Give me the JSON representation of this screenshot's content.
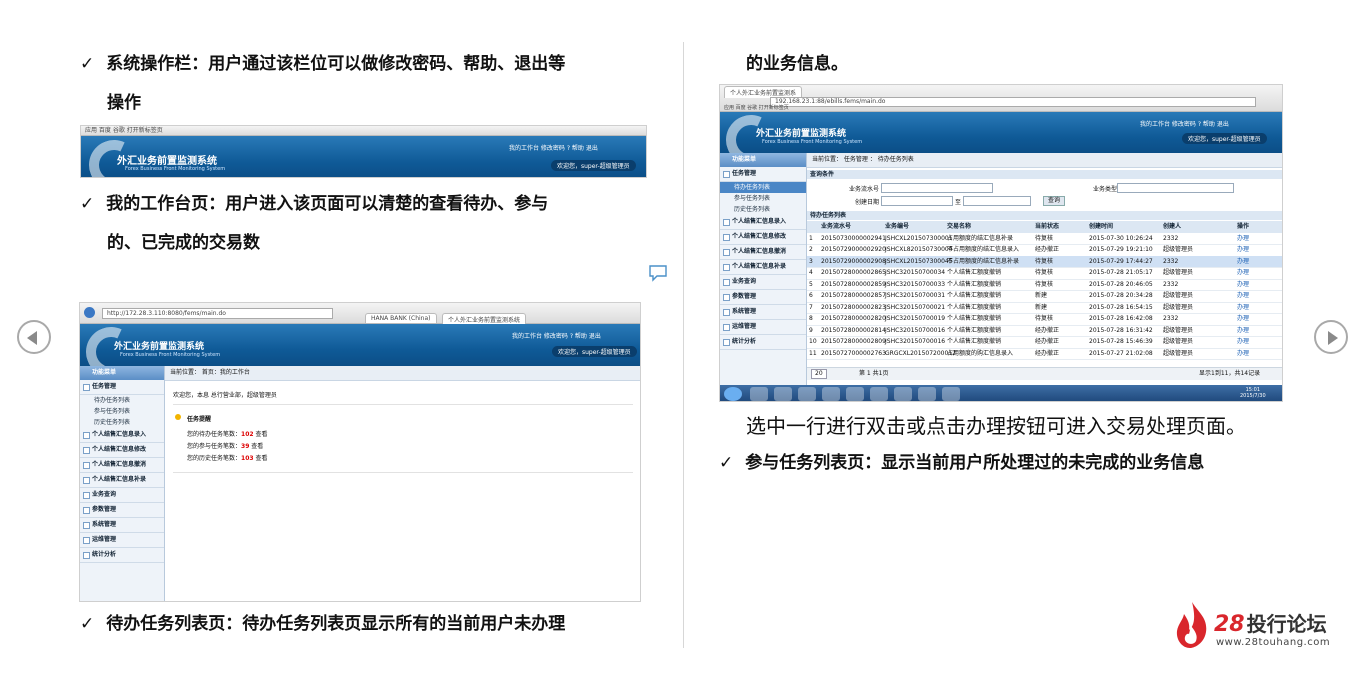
{
  "texts": {
    "left_bullet_1_line1": "系统操作栏：用户通过该栏位可以做修改密码、帮助、退出等",
    "left_bullet_1_line2": "操作",
    "left_bullet_2_line1": "我的工作台页：用户进入该页面可以清楚的查看待办、参与",
    "left_bullet_2_line2": "的、已完成的交易数",
    "left_bullet_3": "待办任务列表页：待办任务列表页显示所有的当前用户未办理",
    "right_top_cont": "的业务信息。",
    "right_caption": "选中一行进行双击或点击办理按钮可进入交易处理页面。",
    "right_bullet": "参与任务列表页：显示当前用户所处理过的未完成的业务信息"
  },
  "check_mark": "✓",
  "app": {
    "system_title": "外汇业务前置监测系统",
    "system_subtitle": "Forex Business Front Monitoring System",
    "links": "我的工作台  修改密码  ? 帮助  退出",
    "welcome": "欢迎您，super-超级管理员",
    "bookmarks": "应用  百度  谷歌  打开新标签页"
  },
  "shot2": {
    "address": "http://172.28.3.110:8080/fems/main.do",
    "tab1": "HANA BANK (China)",
    "tab2": "个人外汇业务前置监测系统",
    "side_head": "功能菜单",
    "side_items": [
      "任务管理",
      "个人结售汇信息录入",
      "个人结售汇信息修改",
      "个人结售汇信息撤消",
      "个人结售汇信息补录",
      "业务查询",
      "参数管理",
      "系统管理",
      "运维管理",
      "统计分析"
    ],
    "side_subs": [
      "待办任务列表",
      "参与任务列表",
      "历史任务列表"
    ],
    "crumb": "当前位置： 首页：我的工作台",
    "greeting": "欢迎您，本息  总行营业部，超级管理员",
    "reminder_title": "任务提醒",
    "lines": [
      {
        "label": "您的待办任务笔数：",
        "count": "102",
        "action": "查看"
      },
      {
        "label": "您的参与任务笔数：",
        "count": "39",
        "action": "查看"
      },
      {
        "label": "您的历史任务笔数：",
        "count": "103",
        "action": "查看"
      }
    ]
  },
  "shot3": {
    "window_tab": "个人外汇业务前置监测系",
    "address": "192.168.23.1:88/ebills.fems/main.do",
    "side_head": "功能菜单",
    "side_items": [
      "任务管理",
      "个人结售汇信息录入",
      "个人结售汇信息修改",
      "个人结售汇信息撤消",
      "个人结售汇信息补录",
      "业务查询",
      "参数管理",
      "系统管理",
      "运维管理",
      "统计分析"
    ],
    "side_subs": [
      "待办任务列表",
      "参与任务列表",
      "历史任务列表"
    ],
    "crumb": "当前位置： 任务管理 ： 待办任务列表",
    "query_title": "查询条件",
    "q_flow": "业务流水号",
    "q_type": "业务类型",
    "q_date": "创建日期",
    "q_to": "至",
    "q_btn": "查询",
    "list_title": "待办任务列表",
    "columns": [
      "业务流水号",
      "业务编号",
      "交易名称",
      "当前状态",
      "创建时间",
      "创建人",
      "操作"
    ],
    "rows": [
      [
        "1",
        "20150730000002941",
        "JSHCXL201507300001",
        "占用额度的结汇信息补录",
        "待复核",
        "2015-07-30 10:26:24",
        "2332",
        "办理"
      ],
      [
        "2",
        "20150729000002920",
        "JSHCXL820150730004",
        "不占用额度的结汇信息录入",
        "经办撤正",
        "2015-07-29 19:21:10",
        "超级管理员",
        "办理"
      ],
      [
        "3",
        "20150729000002908",
        "JSHCXL201507300045",
        "不占用额度的结汇信息补录",
        "待复核",
        "2015-07-29 17:44:27",
        "2332",
        "办理"
      ],
      [
        "4",
        "20150728000002865",
        "JSHC320150700034",
        "个人结售汇额度撤销",
        "待复核",
        "2015-07-28 21:05:17",
        "超级管理员",
        "办理"
      ],
      [
        "5",
        "20150728000002859",
        "JSHC320150700033",
        "个人结售汇额度撤销",
        "待复核",
        "2015-07-28 20:46:05",
        "2332",
        "办理"
      ],
      [
        "6",
        "20150728000002857",
        "JSHC320150700031",
        "个人结售汇额度撤销",
        "新建",
        "2015-07-28 20:34:28",
        "超级管理员",
        "办理"
      ],
      [
        "7",
        "20150728000002823",
        "JSHC320150700021",
        "个人结售汇额度撤销",
        "新建",
        "2015-07-28 16:54:15",
        "超级管理员",
        "办理"
      ],
      [
        "8",
        "20150728000002820",
        "JSHC320150700019",
        "个人结售汇额度撤销",
        "待复核",
        "2015-07-28 16:42:08",
        "2332",
        "办理"
      ],
      [
        "9",
        "20150728000002814",
        "JSHC320150700016",
        "个人结售汇额度撤销",
        "经办撤正",
        "2015-07-28 16:31:42",
        "超级管理员",
        "办理"
      ],
      [
        "10",
        "20150728000002809",
        "JSHC320150700016",
        "个人结售汇额度撤销",
        "经办撤正",
        "2015-07-28 15:46:39",
        "超级管理员",
        "办理"
      ],
      [
        "11",
        "20150727000002763",
        "GRGCXL201507200012",
        "占用额度的购汇信息录入",
        "经办撤正",
        "2015-07-27 21:02:08",
        "超级管理员",
        "办理"
      ]
    ],
    "pager_size": "20",
    "pager_text": "第 1 共1页",
    "pager_info": "显示1到11，共14记录",
    "clock_time": "15:01",
    "clock_date": "2015/7/30"
  },
  "logo": {
    "brand_number": "28",
    "brand_name": "投行论坛",
    "url": "www.28touhang.com",
    "brand_color": "#d9262c"
  }
}
